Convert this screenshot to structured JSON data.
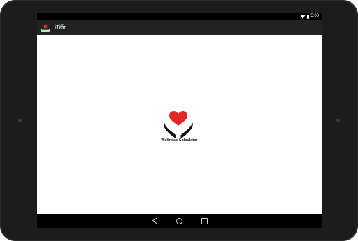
{
  "status_bar": {
    "time": "5:00"
  },
  "app": {
    "title": "iTiffin"
  },
  "splash": {
    "caption": "Wellness Calculator"
  },
  "nav": {
    "back": "back",
    "home": "home",
    "recents": "recents"
  },
  "colors": {
    "heart": "#e32727",
    "hands": "#111111",
    "action_bar": "#222222"
  }
}
